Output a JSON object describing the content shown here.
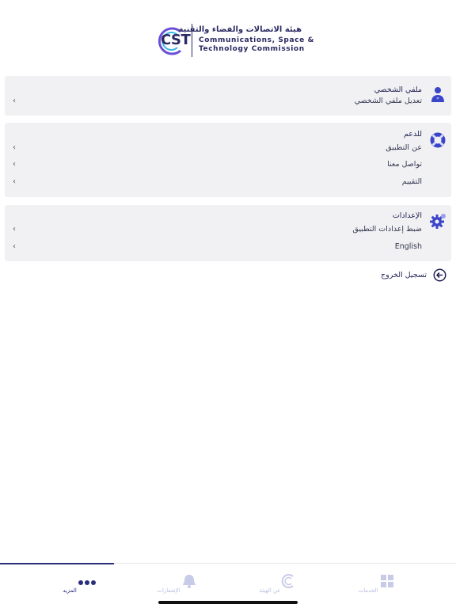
{
  "header": {
    "logo_text": "CST",
    "name_ar": "هيئة الاتصالات والفضاء والتقنية",
    "name_en_line1": "Communications, Space &",
    "name_en_line2": "Technology Commission"
  },
  "profile": {
    "title": "ملفي الشخصي",
    "icon": "user-icon",
    "items": [
      {
        "label": "تعديل ملفي الشخصي"
      }
    ]
  },
  "support": {
    "title": "للدعم",
    "icon": "lifebuoy-icon",
    "items": [
      {
        "label": "عن التطبيق"
      },
      {
        "label": "تواصل معنا"
      },
      {
        "label": "التقييم"
      }
    ]
  },
  "settings": {
    "title": "الإعدادات",
    "icon": "gear-icon",
    "items": [
      {
        "label": "ضبط إعدادات التطبيق"
      },
      {
        "label": "English"
      }
    ]
  },
  "logout": {
    "label": "تسجيل الخروج",
    "icon": "logout-icon"
  },
  "tabbar": {
    "tabs": [
      {
        "label": "المزيد",
        "icon": "more-dots-icon",
        "active": true
      },
      {
        "label": "الإشعارات",
        "icon": "bell-icon",
        "active": false
      },
      {
        "label": "عن الهيئة",
        "icon": "cst-logo-icon",
        "active": false
      },
      {
        "label": "الخدمات",
        "icon": "grid-icon",
        "active": false
      }
    ]
  },
  "colors": {
    "accent": "#2a2f7a",
    "icon_blue": "#3b45c8",
    "card_bg": "#f1f1f3",
    "inactive": "#b9bde0"
  }
}
